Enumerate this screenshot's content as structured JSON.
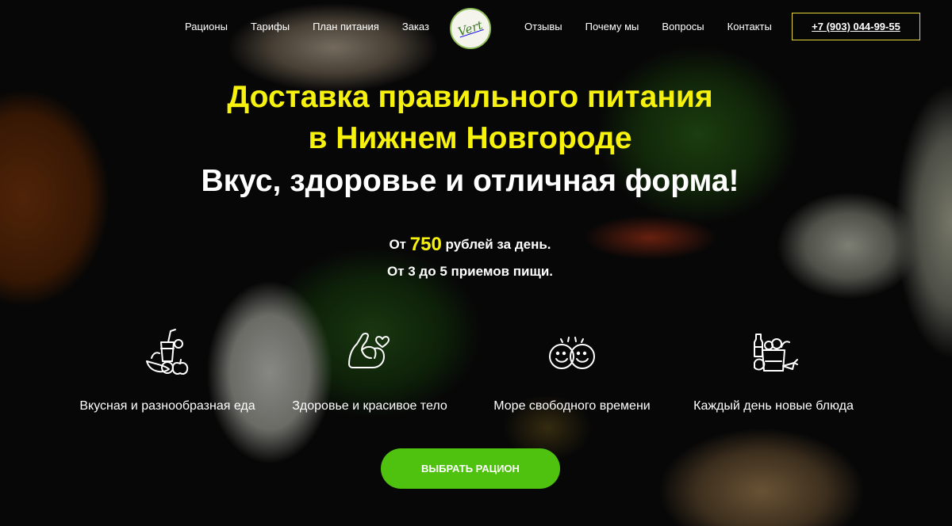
{
  "header": {
    "nav_left": [
      "Рационы",
      "Тарифы",
      "План питания",
      "Заказ"
    ],
    "nav_right": [
      "Отзывы",
      "Почему мы",
      "Вопросы",
      "Контакты"
    ],
    "logo_text": "Vert",
    "phone": "+7 (903) 044-99-55"
  },
  "hero": {
    "title_line1": "Доставка правильного питания",
    "title_line2": "в Нижнем Новгороде",
    "subtitle": "Вкус, здоровье и отличная форма!",
    "price_prefix": "От",
    "price_value": "750",
    "price_suffix": "рублей за день.",
    "meals": "От 3 до 5 приемов пищи."
  },
  "features": [
    {
      "icon": "healthy-food-icon",
      "label": "Вкусная и разнообразная еда"
    },
    {
      "icon": "muscle-heart-icon",
      "label": "Здоровье и красивое тело"
    },
    {
      "icon": "smiley-faces-icon",
      "label": "Море свободного времени"
    },
    {
      "icon": "grocery-bag-icon",
      "label": "Каждый день новые блюда"
    }
  ],
  "cta": {
    "label": "ВЫБРАТЬ РАЦИОН"
  },
  "colors": {
    "accent_yellow": "#f6f10d",
    "cta_green": "#4ec20f",
    "phone_border": "#e3d53a"
  }
}
